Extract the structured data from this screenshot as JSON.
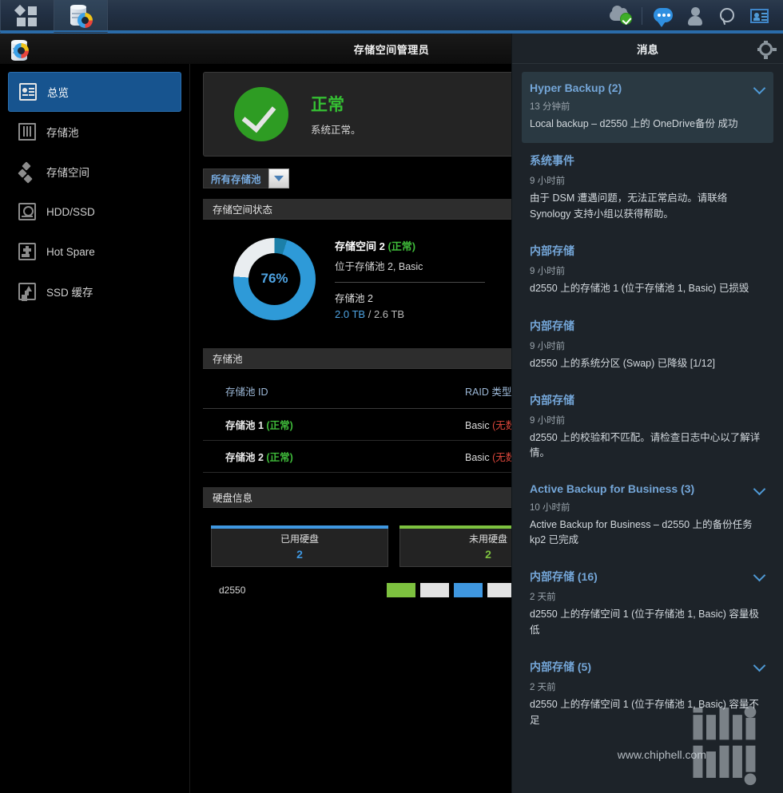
{
  "taskbar": {
    "left_items": [
      {
        "name": "main-menu",
        "icon": "grid-icon"
      },
      {
        "name": "storage-manager",
        "icon": "storage-manager-icon"
      }
    ],
    "right_items": [
      {
        "name": "cloud-status",
        "icon": "cloud-check-icon"
      },
      {
        "name": "notifications",
        "icon": "chat-bubble-icon"
      },
      {
        "name": "user-account",
        "icon": "user-icon"
      },
      {
        "name": "search",
        "icon": "search-icon"
      },
      {
        "name": "widgets",
        "icon": "id-card-icon"
      }
    ]
  },
  "app": {
    "title": "存储空间管理员",
    "icon": "storage-manager-icon"
  },
  "sidebar": {
    "items": [
      {
        "label": "总览",
        "icon": "overview-icon",
        "selected": true
      },
      {
        "label": "存储池",
        "icon": "storage-pool-icon",
        "selected": false
      },
      {
        "label": "存储空间",
        "icon": "volume-icon",
        "selected": false
      },
      {
        "label": "HDD/SSD",
        "icon": "hdd-icon",
        "selected": false
      },
      {
        "label": "Hot Spare",
        "icon": "hot-spare-icon",
        "selected": false
      },
      {
        "label": "SSD 缓存",
        "icon": "ssd-cache-icon",
        "selected": false
      }
    ]
  },
  "main": {
    "status": {
      "icon": "green-check-icon",
      "heading": "正常",
      "subtext": "系统正常。",
      "color": "#35c033"
    },
    "filter": {
      "label": "所有存储池",
      "arrow_icon": "chevron-down-icon"
    },
    "volume_section": {
      "header": "存储空间状态",
      "volume": {
        "percent": "76%",
        "percent_value": 76,
        "title": "存储空间 2",
        "status": "(正常)",
        "location": "位于存储池 2, Basic",
        "pool_label": "存储池 2",
        "used": "2.0 TB",
        "separator": "/",
        "total": "2.6 TB",
        "ring_used_color": "#2e9ad8",
        "ring_free_color": "#e9edf0"
      }
    },
    "pool_section": {
      "header": "存储池",
      "columns": [
        "存储池 ID",
        "RAID 类型"
      ],
      "rows": [
        {
          "id": "存储池 1",
          "status": "(正常)",
          "raid": "Basic",
          "raid_note": "(无数据保护"
        },
        {
          "id": "存储池 2",
          "status": "(正常)",
          "raid": "Basic",
          "raid_note": "(无数据保护"
        }
      ]
    },
    "disk_section": {
      "header": "硬盘信息",
      "cards": [
        {
          "label": "已用硬盘",
          "value": "2",
          "color": "#3f97e0"
        },
        {
          "label": "未用硬盘",
          "value": "2",
          "color": "#7dc13f"
        }
      ],
      "host": "d2550",
      "slots": [
        "green",
        "empty",
        "blue",
        "empty",
        "blue"
      ]
    }
  },
  "notifications": {
    "title": "消息",
    "gear_icon": "gear-icon",
    "items": [
      {
        "title": "Hyper Backup (2)",
        "time": "13 分钟前",
        "text": "Local backup – d2550 上的 OneDrive备份 成功",
        "expandable": true,
        "highlighted": true
      },
      {
        "title": "系统事件",
        "time": "9 小时前",
        "text": "由于 DSM 遭遇问题，无法正常启动。请联络 Synology 支持小组以获得帮助。",
        "expandable": false,
        "highlighted": false
      },
      {
        "title": "内部存储",
        "time": "9 小时前",
        "text": "d2550 上的存储池 1 (位于存储池 1, Basic) 已损毁",
        "expandable": false,
        "highlighted": false
      },
      {
        "title": "内部存储",
        "time": "9 小时前",
        "text": "d2550 上的系统分区 (Swap) 已降级 [1/12]",
        "expandable": false,
        "highlighted": false
      },
      {
        "title": "内部存储",
        "time": "9 小时前",
        "text": "d2550 上的校验和不匹配。请检查日志中心以了解详情。",
        "expandable": false,
        "highlighted": false
      },
      {
        "title": "Active Backup for Business (3)",
        "time": "10 小时前",
        "text": "Active Backup for Business – d2550 上的备份任务 kp2 已完成",
        "expandable": true,
        "highlighted": false
      },
      {
        "title": "内部存储 (16)",
        "time": "2 天前",
        "text": "d2550 上的存储空间 1 (位于存储池 1, Basic) 容量极低",
        "expandable": true,
        "highlighted": false
      },
      {
        "title": "内部存储 (5)",
        "time": "2 天前",
        "text": "d2550 上的存储空间 1 (位于存储池 1, Basic) 容量不足",
        "expandable": true,
        "highlighted": false
      }
    ]
  },
  "watermark": {
    "url": "www.chiphell.com"
  }
}
